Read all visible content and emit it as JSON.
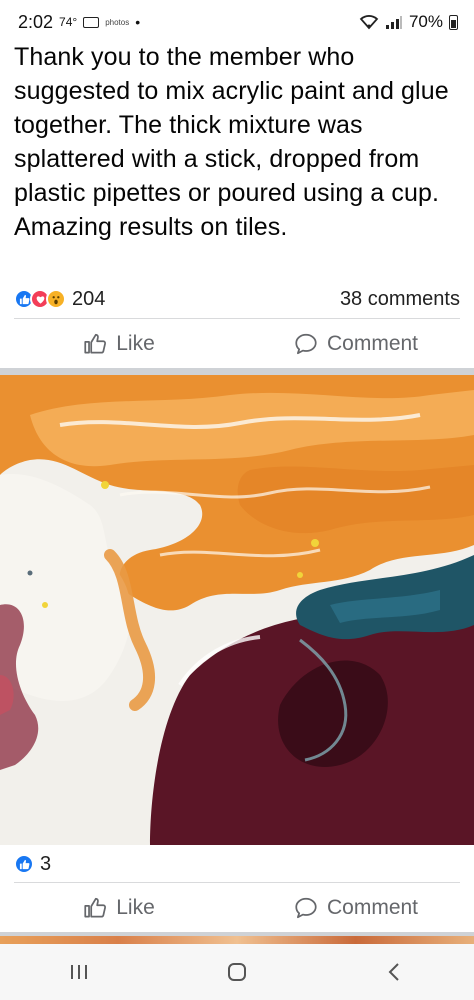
{
  "status_bar": {
    "time": "2:02",
    "temperature": "74°",
    "notification_label": "photos",
    "dot": "•",
    "battery": "70%"
  },
  "post": {
    "text": "Thank you to the member who suggested to mix acrylic paint and glue together. The thick mixture was splattered with a stick, dropped from plastic pipettes or poured using a cup. Amazing results on tiles.",
    "reactions": {
      "icons": [
        "like-icon",
        "love-icon",
        "wow-icon"
      ],
      "count": "204",
      "comments": "38 comments"
    },
    "actions": {
      "like_label": "Like",
      "comment_label": "Comment"
    }
  },
  "photo": {
    "description_icon": "acrylic-pour-painting",
    "reactions_count": "3",
    "actions": {
      "like_label": "Like",
      "comment_label": "Comment"
    }
  },
  "nav_bar": {
    "recent_icon": "recent-apps-icon",
    "home_icon": "home-icon",
    "back_icon": "back-icon"
  },
  "colors": {
    "facebook_blue": "#1877f2",
    "love_red": "#f33e58",
    "wow_yellow": "#f7b125",
    "secondary_text": "#65676b"
  }
}
